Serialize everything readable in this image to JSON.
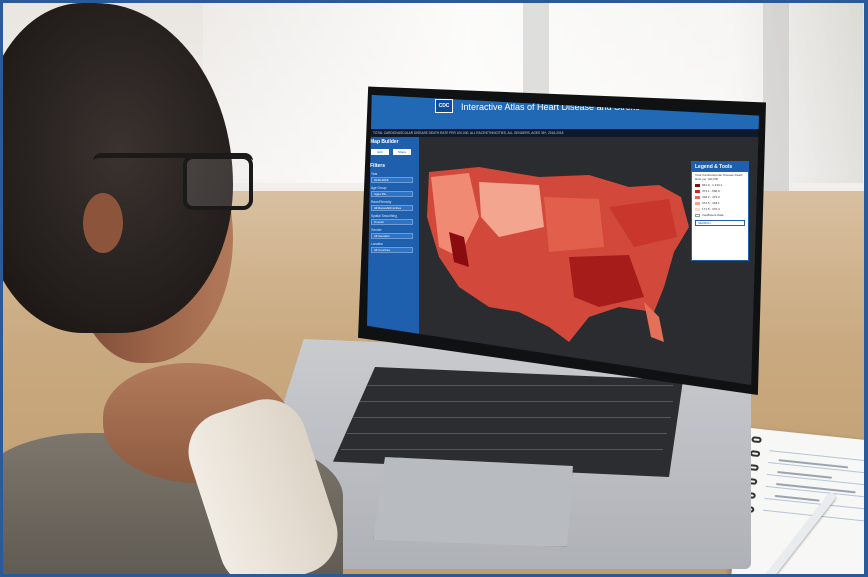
{
  "screen": {
    "logo_text": "CDC",
    "app_title": "Interactive Atlas of Heart Disease and Stroke",
    "subtitle": "TOTAL CARDIOVASCULAR DISEASE DEATH RATE PER 100,000, ALL RACE/ETHNICITIES, ALL GENDERS, AGES 35+, 2016-2018",
    "sidebar": {
      "title": "Map Builder",
      "button_1": "Edit",
      "button_2": "Share",
      "filters_heading": "Filters",
      "fields": [
        "2016-2018",
        "Ages 35+",
        "All Races/Ethnicities",
        "Overall",
        "All Genders",
        "All Counties"
      ],
      "labels": [
        "Year",
        "Age Group",
        "Race/Ethnicity",
        "Spatial Smoothing",
        "Gender",
        "Location"
      ]
    },
    "legend": {
      "title": "Legend & Tools",
      "subtitle": "Total Cardiovascular Disease Death Rate per 100,000",
      "rows": [
        {
          "label": "561.0 - 1,134.1",
          "color": "#8b0c10"
        },
        {
          "label": "473.1 - 560.9",
          "color": "#c52a24"
        },
        {
          "label": "418.2 - 473.0",
          "color": "#e46a52"
        },
        {
          "label": "372.5 - 418.1",
          "color": "#f3a38c"
        },
        {
          "label": "171.5 - 372.4",
          "color": "#fbd8cb"
        },
        {
          "label": "Insufficient Data",
          "color": "#ffffff"
        }
      ],
      "search_placeholder": "SEARCH"
    }
  },
  "colors": {
    "header_blue": "#2169b5",
    "sidebar_blue": "#1e5fae",
    "map_dark": "#2a2c30"
  }
}
